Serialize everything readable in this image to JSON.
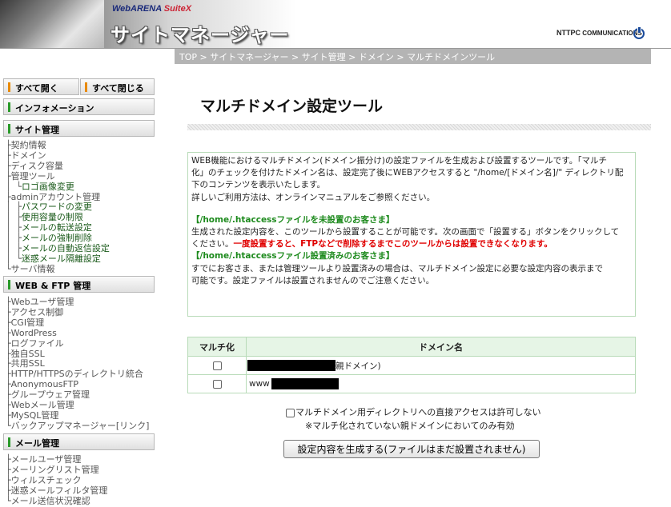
{
  "header": {
    "brand": "WebARENA",
    "brand_suite": "SuiteX",
    "title": "サイトマネージャー",
    "ntt_logo_main": "NTTPC",
    "ntt_logo_sub": "COMMUNICATIONS"
  },
  "breadcrumb": "TOP > サイトマネージャー > サイト管理 > ドメイン > マルチドメインツール",
  "sidebar": {
    "open_all": "すべて開く",
    "close_all": "すべて閉じる",
    "info": "インフォメーション",
    "site_admin": "サイト管理",
    "site_items": [
      {
        "branch": "├",
        "label": "契約情報"
      },
      {
        "branch": "├",
        "label": "ドメイン"
      },
      {
        "branch": "├",
        "label": "ディスク容量"
      },
      {
        "branch": "├",
        "label": "管理ツール"
      },
      {
        "branch": "│ └",
        "label": "ロゴ画像変更"
      },
      {
        "branch": "├",
        "label": "adminアカウント管理"
      },
      {
        "branch": "│ ├",
        "label": "パスワードの変更"
      },
      {
        "branch": "│ ├",
        "label": "使用容量の制限"
      },
      {
        "branch": "│ ├",
        "label": "メールの転送設定"
      },
      {
        "branch": "│ ├",
        "label": "メールの強制削除"
      },
      {
        "branch": "│ ├",
        "label": "メールの自動返信設定"
      },
      {
        "branch": "│ └",
        "label": "迷惑メール隔離設定"
      },
      {
        "branch": "└",
        "label": "サーバ情報"
      }
    ],
    "web_ftp": "WEB & FTP 管理",
    "web_items": [
      {
        "branch": "├",
        "label": "Webユーザ管理"
      },
      {
        "branch": "├",
        "label": "アクセス制御"
      },
      {
        "branch": "├",
        "label": "CGI管理"
      },
      {
        "branch": "├",
        "label": "WordPress"
      },
      {
        "branch": "├",
        "label": "ログファイル"
      },
      {
        "branch": "├",
        "label": "独自SSL"
      },
      {
        "branch": "├",
        "label": "共用SSL"
      },
      {
        "branch": "├",
        "label": "HTTP/HTTPSのディレクトリ統合"
      },
      {
        "branch": "├",
        "label": "AnonymousFTP"
      },
      {
        "branch": "├",
        "label": "グループウェア管理"
      },
      {
        "branch": "├",
        "label": "Webメール管理"
      },
      {
        "branch": "├",
        "label": "MySQL管理"
      },
      {
        "branch": "└",
        "label": "バックアップマネージャー[リンク]"
      }
    ],
    "mail_admin": "メール管理",
    "mail_items": [
      {
        "branch": "├",
        "label": "メールユーザ管理"
      },
      {
        "branch": "├",
        "label": "メーリングリスト管理"
      },
      {
        "branch": "├",
        "label": "ウィルスチェック"
      },
      {
        "branch": "├",
        "label": "迷惑メールフィルタ管理"
      },
      {
        "branch": "└",
        "label": "メール送信状況確認"
      }
    ]
  },
  "main": {
    "title": "マルチドメイン設定ツール",
    "intro": [
      "WEB機能におけるマルチドメイン(ドメイン振分け)の設定ファイルを生成および設置するツールです。「マルチ",
      "化」のチェックを付けたドメイン名は、設定完了後にWEBアクセスすると \"/home/[ドメイン名]/\" ディレクトリ配",
      "下のコンテンツを表示いたします。",
      "詳しいご利用方法は、オンラインマニュアルをご参照ください。"
    ],
    "section1_heading": "【/home/.htaccessファイルを未設置のお客さま】",
    "section1_lines": [
      "生成された設定内容を、このツールから設置することが可能です。次の画面で「設置する」ボタンをクリックして",
      "ください。"
    ],
    "section1_warning": "一度設置すると、FTPなどで削除するまでこのツールからは設置できなくなります。",
    "section2_heading": "【/home/.htaccessファイル設置済みのお客さま】",
    "section2_lines": [
      "すでにお客さま、または管理ツールより設置済みの場合は、マルチドメイン設定に必要な設定内容の表示まで",
      "可能です。設定ファイルは設置されませんのでご注意ください。"
    ],
    "table": {
      "col_multi": "マルチ化",
      "col_domain": "ドメイン名",
      "rows": [
        {
          "domain_suffix": "親ドメイン)",
          "checked": false
        },
        {
          "domain_prefix": "www",
          "checked": false
        }
      ]
    },
    "direct_access_label": "マルチドメイン用ディレクトリへの直接アクセスは許可しない",
    "direct_access_note": "※マルチ化されていない親ドメインにおいてのみ有効",
    "generate_button": "設定内容を生成する(ファイルはまだ設置されません)"
  }
}
